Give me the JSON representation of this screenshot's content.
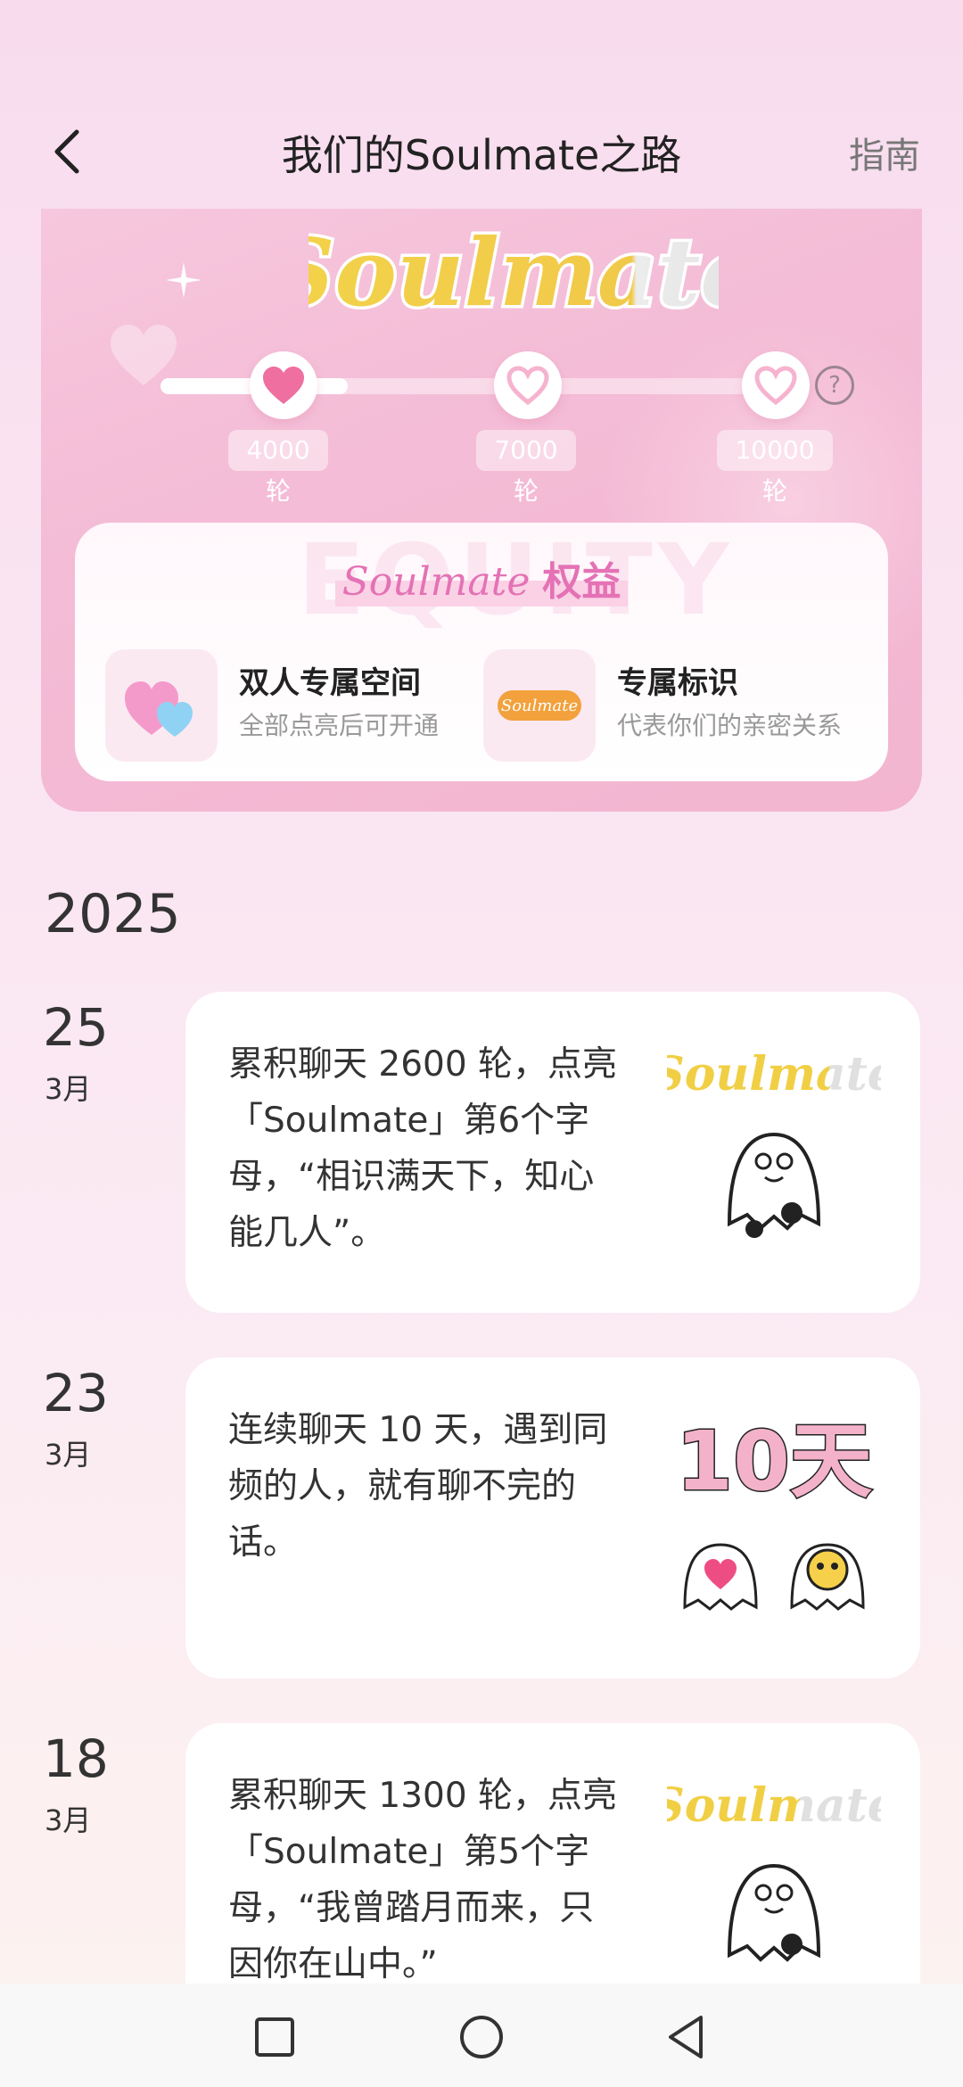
{
  "header": {
    "title": "我们的Soulmate之路",
    "guide": "指南",
    "back_icon": "chevron-left-icon"
  },
  "progress": {
    "logo_text": "Soulmate",
    "lit_letters": 6,
    "total_letters": 8,
    "fraction": 0.3,
    "milestones": [
      {
        "label": "4000轮",
        "reached": true
      },
      {
        "label": "7000轮",
        "reached": false
      },
      {
        "label": "10000轮",
        "reached": false
      }
    ],
    "help_icon": "question-circle-icon"
  },
  "benefits": {
    "watermark": "EQUITY",
    "title_prefix": "Soulmate",
    "title_suffix": "权益",
    "items": [
      {
        "name": "双人专属空间",
        "desc": "全部点亮后可开通",
        "icon": "double-heart-icon"
      },
      {
        "name": "专属标识",
        "desc": "代表你们的亲密关系",
        "icon": "soulmate-badge-icon",
        "badge_text": "Soulmate"
      }
    ]
  },
  "timeline": {
    "year": "2025",
    "entries": [
      {
        "day": "25",
        "month": "3月",
        "text": "累积聊天 2600 轮，点亮「Soulmate」第6个字母，“相识满天下，知心能几人”。",
        "art": "soulmate-ghost-art",
        "art_text": "Soulmate"
      },
      {
        "day": "23",
        "month": "3月",
        "text": "连续聊天 10 天，遇到同频的人，就有聊不完的话。",
        "art": "ten-days-ghosts-art",
        "art_text": "10天"
      },
      {
        "day": "18",
        "month": "3月",
        "text": "累积聊天 1300 轮，点亮「Soulmate」第5个字母，“我曾踏月而来，只因你在山中。”",
        "art": "soulmate-ghost-art",
        "art_text": "Soulmate"
      }
    ]
  },
  "colors": {
    "accent": "#ee6fa0",
    "gold": "#f3cf45",
    "pink_bg": "#f6c7dd"
  },
  "navbar": {
    "icons": [
      "recents-square-icon",
      "home-circle-icon",
      "back-triangle-icon"
    ]
  }
}
